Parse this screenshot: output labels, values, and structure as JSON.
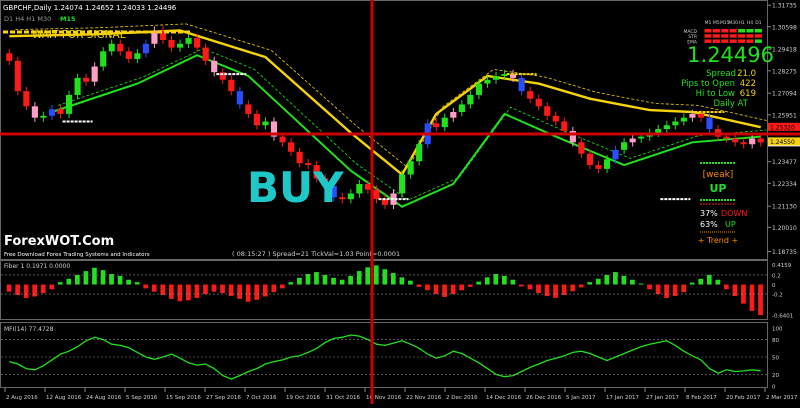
{
  "header": {
    "symbol_line": "GBPCHF,Daily  1.24074 1.24652 1.24033 1.24496",
    "tf_line": "D1 H4 H1 M30",
    "tf_current": "M15",
    "signal": "WAIT FOR SIGNAL"
  },
  "big_label": "BUY",
  "watermark": {
    "title": "ForexWOT.Com",
    "subtitle": "Free Download Forex Trading Systems and Indicators"
  },
  "status_bar": "( 08:15:27 )   Spread=21   TickVal=1.03   Point=0.0001",
  "panel": {
    "row_labels": [
      "MACD",
      "STR",
      "EMA"
    ],
    "tf_labels": [
      "M1",
      "M5",
      "M15",
      "M30",
      "H1",
      "H4",
      "D1"
    ],
    "price": "1.24496",
    "spread_label": "Spread",
    "spread_value": "21.0",
    "pips_label": "Pips to Open",
    "pips_value": "422",
    "hilo_label": "Hi to Low",
    "hilo_value": "619",
    "daily_label": "Daily AT",
    "weak": "[weak]",
    "up": "UP",
    "down_pct": "37%",
    "down_label": "DOWN",
    "up_pct": "63%",
    "up_label": "UP",
    "trend": "+   Trend   +"
  },
  "osc1": {
    "label": "Fiber 1 0.1971 0.0000"
  },
  "osc2": {
    "label": "MFI(14) 77.4728"
  },
  "colors": {
    "bull": "#22e01e",
    "bear": "#ff1a1a",
    "pink": "#ff9ec6",
    "blue": "#2a4dff",
    "yellow": "#f5d20a",
    "crosshair": "#cc0000"
  },
  "chart_data": [
    {
      "type": "candlestick",
      "title": "GBPCHF,Daily",
      "ohlc_last": {
        "open": 1.24074,
        "high": 1.24652,
        "low": 1.24033,
        "close": 1.24496
      },
      "y_ticks": [
        1.31735,
        1.30598,
        1.29418,
        1.28275,
        1.27094,
        1.25951,
        1.23477,
        1.22334,
        1.2113,
        1.2001,
        1.18735
      ],
      "y_highlights": [
        {
          "value": 1.24496,
          "color": "#f0f0f0"
        },
        {
          "value": 1.2532,
          "color": "#ff1a1a"
        },
        {
          "value": 1.2455,
          "color": "#f5d20a"
        }
      ],
      "ylim": [
        1.185,
        1.318
      ],
      "x_ticks": [
        "2 Aug 2016",
        "12 Aug 2016",
        "24 Aug 2016",
        "5 Sep 2016",
        "15 Sep 2016",
        "27 Sep 2016",
        "7 Oct 2016",
        "19 Oct 2016",
        "31 Oct 2016",
        "10 Nov 2016",
        "22 Nov 2016",
        "2 Dec 2016",
        "14 Dec 2016",
        "26 Dec 2016",
        "5 Jan 2017",
        "17 Jan 2017",
        "27 Jan 2017",
        "8 Feb 2017",
        "20 Feb 2017",
        "2 Mar 2017"
      ],
      "closes": [
        1.288,
        1.272,
        1.264,
        1.258,
        1.259,
        1.2625,
        1.26,
        1.27,
        1.279,
        1.277,
        1.285,
        1.293,
        1.297,
        1.293,
        1.289,
        1.292,
        1.297,
        1.304,
        1.299,
        1.295,
        1.297,
        1.3,
        1.295,
        1.288,
        1.282,
        1.278,
        1.272,
        1.265,
        1.26,
        1.254,
        1.256,
        1.248,
        1.245,
        1.24,
        1.234,
        1.233,
        1.226,
        1.222,
        1.216,
        1.215,
        1.218,
        1.223,
        1.22,
        1.215,
        1.212,
        1.218,
        1.228,
        1.235,
        1.244,
        1.255,
        1.253,
        1.258,
        1.261,
        1.265,
        1.27,
        1.276,
        1.278,
        1.28,
        1.281,
        1.279,
        1.272,
        1.268,
        1.264,
        1.259,
        1.256,
        1.251,
        1.245,
        1.239,
        1.233,
        1.231,
        1.236,
        1.241,
        1.245,
        1.247,
        1.248,
        1.25,
        1.252,
        1.254,
        1.256,
        1.258,
        1.26,
        1.258,
        1.252,
        1.248,
        1.247,
        1.245,
        1.244,
        1.247,
        1.245
      ],
      "lines": [
        {
          "name": "",
          "color": "#f5d20a",
          "values": [
            [
              0,
              1.301
            ],
            [
              10,
              1.302
            ],
            [
              20,
              1.304
            ],
            [
              30,
              1.29
            ],
            [
              40,
              1.25
            ],
            [
              46,
              1.228
            ],
            [
              50,
              1.26
            ],
            [
              56,
              1.28
            ],
            [
              62,
              1.276
            ],
            [
              68,
              1.268
            ],
            [
              75,
              1.262
            ],
            [
              80,
              1.261
            ],
            [
              88,
              1.253
            ]
          ]
        },
        {
          "name": "",
          "color": "#22e01e",
          "values": [
            [
              5,
              1.261
            ],
            [
              15,
              1.276
            ],
            [
              22,
              1.291
            ],
            [
              28,
              1.28
            ],
            [
              40,
              1.23
            ],
            [
              46,
              1.211
            ],
            [
              52,
              1.223
            ],
            [
              58,
              1.26
            ],
            [
              64,
              1.248
            ],
            [
              72,
              1.233
            ],
            [
              80,
              1.245
            ],
            [
              88,
              1.248
            ]
          ]
        }
      ]
    },
    {
      "type": "bar",
      "title": "Fiber 1 0.1971 0.0000",
      "y_ticks": [
        0.4159,
        0.2,
        0,
        -0.2,
        -0.6401
      ],
      "ylim": [
        -0.7,
        0.45
      ],
      "values": [
        -0.15,
        -0.22,
        -0.28,
        -0.25,
        -0.18,
        -0.1,
        0.05,
        0.12,
        0.2,
        0.28,
        0.35,
        0.3,
        0.22,
        0.18,
        0.1,
        0.05,
        -0.08,
        -0.15,
        -0.22,
        -0.3,
        -0.35,
        -0.33,
        -0.28,
        -0.2,
        -0.15,
        -0.18,
        -0.24,
        -0.3,
        -0.36,
        -0.32,
        -0.25,
        -0.16,
        -0.08,
        0.05,
        0.14,
        0.22,
        0.26,
        0.2,
        0.14,
        0.1,
        0.18,
        0.28,
        0.36,
        0.4,
        0.32,
        0.24,
        0.15,
        0.08,
        -0.05,
        -0.12,
        -0.2,
        -0.26,
        -0.2,
        -0.12,
        -0.05,
        0.06,
        0.15,
        0.22,
        0.18,
        0.1,
        -0.04,
        -0.1,
        -0.18,
        -0.24,
        -0.28,
        -0.22,
        -0.14,
        -0.06,
        0.05,
        0.12,
        0.2,
        0.26,
        0.18,
        0.1,
        0.02,
        -0.1,
        -0.2,
        -0.28,
        -0.24,
        -0.16,
        0.04,
        0.12,
        0.2,
        0.1,
        -0.1,
        -0.24,
        -0.4,
        -0.55,
        -0.64
      ]
    },
    {
      "type": "line",
      "title": "MFI(14) 77.4728",
      "y_ticks": [
        100,
        80,
        50,
        20,
        0
      ],
      "ylim": [
        0,
        100
      ],
      "values": [
        42,
        38,
        30,
        28,
        35,
        45,
        55,
        60,
        68,
        78,
        84,
        80,
        72,
        70,
        66,
        58,
        50,
        46,
        50,
        55,
        48,
        40,
        36,
        38,
        30,
        18,
        12,
        18,
        25,
        30,
        38,
        42,
        45,
        50,
        52,
        58,
        65,
        75,
        82,
        84,
        88,
        86,
        80,
        72,
        70,
        74,
        78,
        72,
        65,
        55,
        48,
        52,
        60,
        56,
        48,
        40,
        30,
        20,
        16,
        18,
        25,
        32,
        38,
        44,
        48,
        52,
        58,
        60,
        56,
        50,
        44,
        50,
        56,
        62,
        68,
        72,
        75,
        78,
        70,
        60,
        52,
        45,
        30,
        22,
        28,
        25,
        26,
        28,
        26
      ]
    }
  ]
}
